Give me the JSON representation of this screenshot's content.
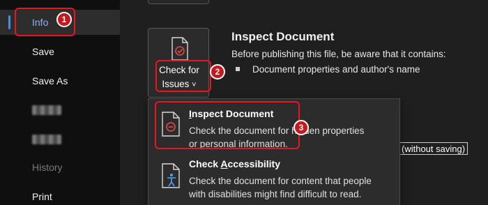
{
  "sidebar": {
    "items": [
      {
        "label": "Info"
      },
      {
        "label": "Save"
      },
      {
        "label": "Save As"
      },
      {
        "label": ""
      },
      {
        "label": ""
      },
      {
        "label": "History"
      },
      {
        "label": "Print"
      }
    ]
  },
  "check_button": {
    "line1": "Check for",
    "line2": "Issues",
    "chevron": "˅"
  },
  "inspect_section": {
    "title": "Inspect Document",
    "description": "Before publishing this file, be aware that it contains:",
    "bullet": "Document properties and author's name"
  },
  "behind_text": "(without saving)",
  "dropdown": {
    "items": [
      {
        "title_prefix": "I",
        "title_rest": "nspect Document",
        "desc_line1": "Check the document for hidden properties",
        "desc_line2": "or personal information.",
        "icon": "inspect-document-icon"
      },
      {
        "title_prefix": "Check ",
        "title_underlined": "A",
        "title_rest": "ccessibility",
        "desc_line1": "Check the document for content that people",
        "desc_line2": "with disabilities might find difficult to read.",
        "icon": "accessibility-icon"
      }
    ]
  },
  "callouts": [
    "1",
    "2",
    "3"
  ],
  "colors": {
    "highlight": "#e8171f",
    "accent": "#4a90e2",
    "sidebar_bg": "#0f0f0f",
    "main_bg": "#1f1f1f"
  }
}
